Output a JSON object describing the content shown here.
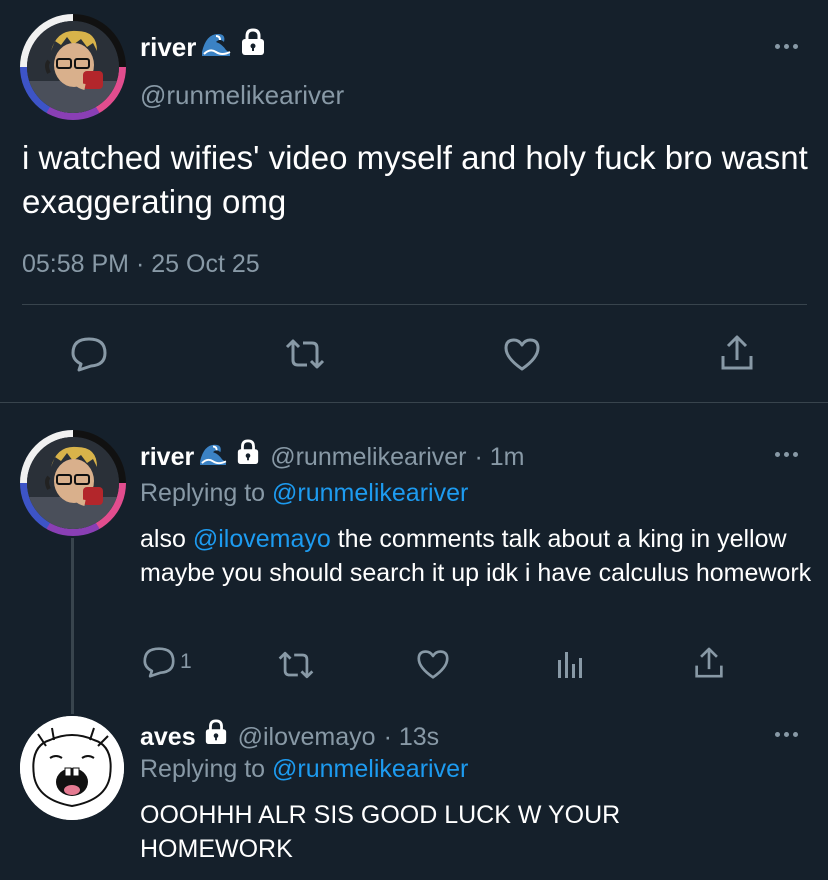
{
  "main_tweet": {
    "display_name": "river",
    "handle": "@runmelikeariver",
    "text": "i watched wifies' video myself and holy fuck bro wasnt exaggerating omg",
    "time": "05:58 PM",
    "separator": "·",
    "date": "25 Oct 25"
  },
  "reply1": {
    "display_name": "river",
    "handle": "@runmelikeariver",
    "age": "· 1m",
    "replying_prefix": "Replying to",
    "replying_to": "@runmelikeariver",
    "mention": "@ilovemayo",
    "text_before": "also",
    "text_after": "the comments talk about a king in yellow maybe you should search it up idk i have calculus homework",
    "reply_count": "1"
  },
  "reply2": {
    "display_name": "aves",
    "handle": "@ilovemayo",
    "age": "· 13s",
    "replying_prefix": "Replying to",
    "replying_to": "@runmelikeariver",
    "text": "OOOHHH ALR SIS GOOD LUCK W YOUR HOMEWORK"
  },
  "icons": [
    "wave-emoji-icon",
    "lock-icon",
    "more-icon",
    "reply-icon",
    "retweet-icon",
    "like-icon",
    "share-icon",
    "analytics-icon"
  ],
  "colors": {
    "background": "#15202b",
    "muted": "#8899a6",
    "link": "#1d9bf0",
    "divider": "#38444d",
    "avatar_ring_pink": "#e24d8e",
    "avatar_ring_purple": "#8a3fb5",
    "avatar_ring_blue": "#3d54c7"
  }
}
